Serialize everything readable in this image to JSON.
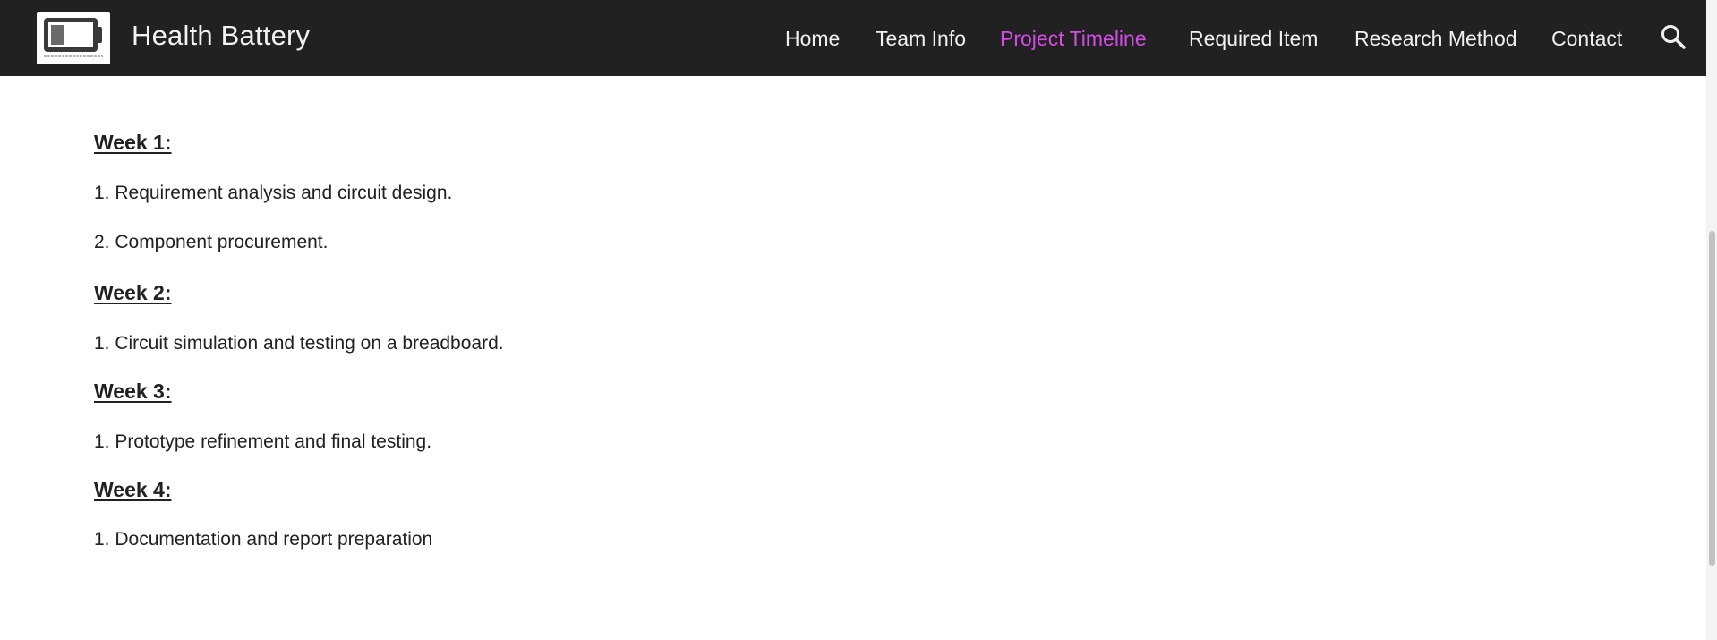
{
  "header": {
    "site_title": "Health Battery",
    "logo": "battery-logo-icon",
    "nav": [
      {
        "label": "Home",
        "active": false
      },
      {
        "label": "Team Info",
        "active": false
      },
      {
        "label": "Project Timeline",
        "active": true
      },
      {
        "label": "Required Item",
        "active": false
      },
      {
        "label": "Research Method",
        "active": false
      },
      {
        "label": "Contact",
        "active": false
      }
    ],
    "search_icon": "search-icon",
    "background_color": "#212121",
    "active_color": "#d54be8"
  },
  "timeline": {
    "week1": {
      "heading": "Week 1:",
      "items": [
        "1. Requirement analysis and circuit design.",
        "2. Component procurement."
      ]
    },
    "week2": {
      "heading": "Week 2:",
      "items": [
        "1. Circuit simulation and testing on a breadboard."
      ]
    },
    "week3": {
      "heading": "Week 3:",
      "items": [
        "1. Prototype refinement and final testing."
      ]
    },
    "week4": {
      "heading": "Week 4:",
      "items": [
        "1. Documentation and report preparation"
      ]
    }
  }
}
